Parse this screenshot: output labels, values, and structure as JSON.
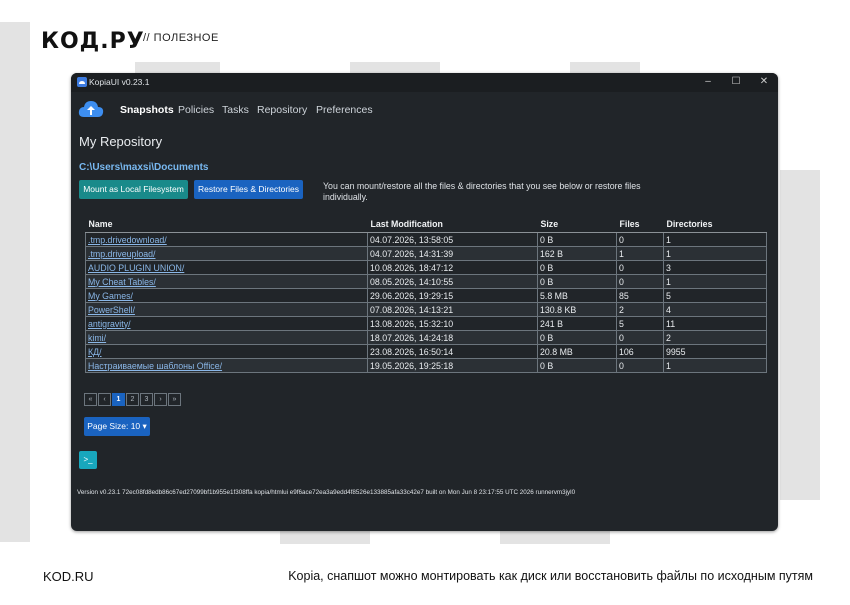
{
  "site": {
    "logo": "КОД.РУ",
    "section": "// ПОЛЕЗНОЕ",
    "footer_brand": "KOD.RU",
    "caption": "Kopia, снапшот можно монтировать как диск или восстановить файлы по исходным путям"
  },
  "window": {
    "title": "KopiaUI v0.23.1",
    "controls": {
      "minimize": "–",
      "maximize": "☐",
      "close": "✕"
    }
  },
  "nav": {
    "logo_icon": "cloud-upload-icon",
    "items": [
      {
        "label": "Snapshots",
        "active": true
      },
      {
        "label": "Policies"
      },
      {
        "label": "Tasks"
      },
      {
        "label": "Repository"
      },
      {
        "label": "Preferences"
      }
    ]
  },
  "page": {
    "heading": "My Repository",
    "path": "C:\\Users\\maxsi\\Documents",
    "mount_button": "Mount as Local Filesystem",
    "restore_button": "Restore Files & Directories",
    "hint": "You can mount/restore all the files & directories that you see below or restore files individually."
  },
  "table": {
    "headers": [
      "Name",
      "Last Modification",
      "Size",
      "Files",
      "Directories"
    ],
    "rows": [
      [
        ".tmp.drivedownload/",
        "04.07.2026, 13:58:05",
        "0 B",
        "0",
        "1"
      ],
      [
        ".tmp.driveupload/",
        "04.07.2026, 14:31:39",
        "162 B",
        "1",
        "1"
      ],
      [
        "AUDIO PLUGIN UNION/",
        "10.08.2026, 18:47:12",
        "0 B",
        "0",
        "3"
      ],
      [
        "My Cheat Tables/",
        "08.05.2026, 14:10:55",
        "0 B",
        "0",
        "1"
      ],
      [
        "My Games/",
        "29.06.2026, 19:29:15",
        "5.8 MB",
        "85",
        "5"
      ],
      [
        "PowerShell/",
        "07.08.2026, 14:13:21",
        "130.8 KB",
        "2",
        "4"
      ],
      [
        "antigravity/",
        "13.08.2026, 15:32:10",
        "241 B",
        "5",
        "11"
      ],
      [
        "kimi/",
        "18.07.2026, 14:24:18",
        "0 B",
        "0",
        "2"
      ],
      [
        "КД/",
        "23.08.2026, 16:50:14",
        "20.8 MB",
        "106",
        "9955"
      ],
      [
        "Настраиваемые шаблоны Office/",
        "19.05.2026, 19:25:18",
        "0 B",
        "0",
        "1"
      ]
    ]
  },
  "pagination": {
    "first": "«",
    "prev": "‹",
    "pages": [
      "1",
      "2",
      "3"
    ],
    "current": "1",
    "next": "›",
    "last": "»"
  },
  "page_size_button": "Page Size: 10 ▾",
  "terminal_button": ">_",
  "version": "Version v0.23.1 72ec08fd8edb86c67ed27099bf1b955e1f308ffa kopia/htmlui e9f6ace72ea3a9edd4f8526e133885afa33c42e7 built on Mon Jun 8 23:17:55 UTC 2026 runnervm3jyl0",
  "colors": {
    "window_bg": "#212529",
    "link": "#8ab7e8",
    "primary": "#1a63c0",
    "success": "#198a8a",
    "info": "#18a7bd"
  }
}
